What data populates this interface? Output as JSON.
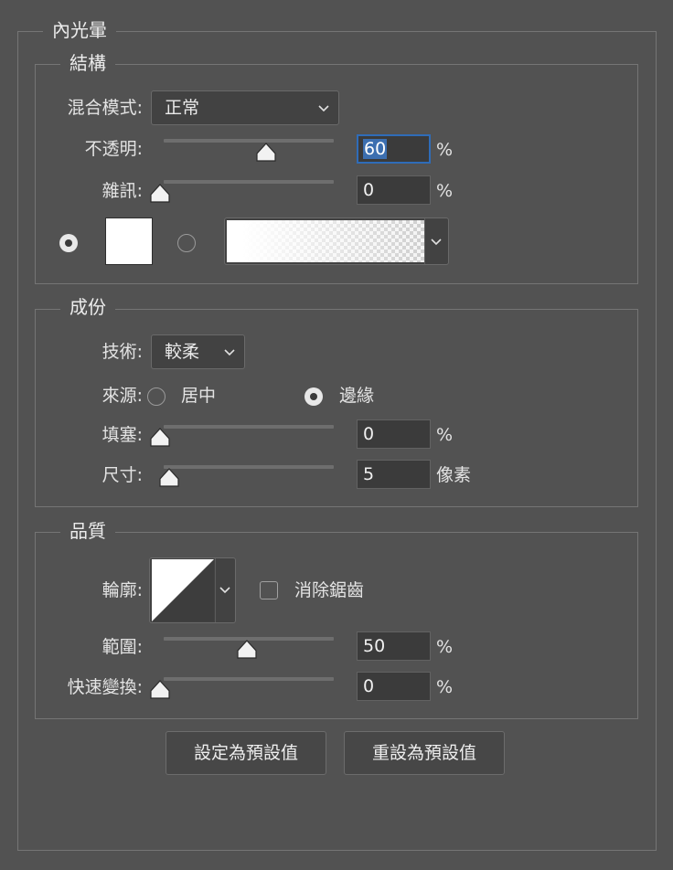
{
  "panel": {
    "title": "內光暈"
  },
  "structure": {
    "title": "結構",
    "blend_mode": {
      "label": "混合模式:",
      "value": "正常"
    },
    "opacity": {
      "label": "不透明:",
      "value": "60",
      "unit": "%",
      "slider_fraction": 0.6
    },
    "noise": {
      "label": "雜訊:",
      "value": "0",
      "unit": "%",
      "slider_fraction": 0.0
    },
    "fill_mode": {
      "selected": "color",
      "color_swatch": "#ffffff"
    }
  },
  "elements": {
    "title": "成份",
    "technique": {
      "label": "技術:",
      "value": "較柔"
    },
    "source": {
      "label": "來源:",
      "options": [
        "居中",
        "邊緣"
      ],
      "selected": "邊緣"
    },
    "choke": {
      "label": "填塞:",
      "value": "0",
      "unit": "%",
      "slider_fraction": 0.0
    },
    "size": {
      "label": "尺寸:",
      "value": "5",
      "unit": "像素",
      "slider_fraction": 0.05
    }
  },
  "quality": {
    "title": "品質",
    "contour": {
      "label": "輪廓:"
    },
    "anti_alias": {
      "label": "消除鋸齒",
      "checked": false
    },
    "range": {
      "label": "範圍:",
      "value": "50",
      "unit": "%",
      "slider_fraction": 0.5
    },
    "jitter": {
      "label": "快速變換:",
      "value": "0",
      "unit": "%",
      "slider_fraction": 0.0
    }
  },
  "buttons": {
    "make_default": "設定為預設值",
    "reset_default": "重設為預設值"
  },
  "icons": {
    "chevron": "chevron-down-icon",
    "slider_thumb": "slider-thumb-icon"
  },
  "colors": {
    "background": "#525252",
    "focus": "#2f6cb8"
  }
}
